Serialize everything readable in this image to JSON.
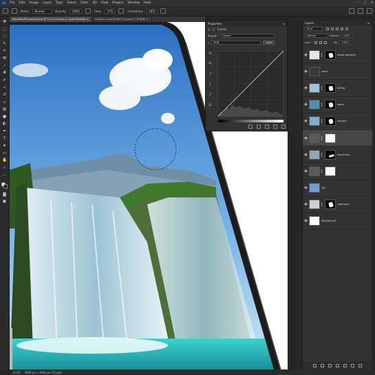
{
  "menubar": {
    "logo": "Ps",
    "items": [
      "File",
      "Edit",
      "Image",
      "Layer",
      "Type",
      "Select",
      "Filter",
      "3D",
      "View",
      "Plugins",
      "Window",
      "Help"
    ],
    "window_controls": [
      "–",
      "□",
      "×"
    ]
  },
  "options": {
    "mode_label": "Mode:",
    "mode_value": "Normal",
    "opacity_label": "Opacity:",
    "opacity_value": "100%",
    "flow_label": "Flow:",
    "flow_value": "37%",
    "smoothing_label": "Smoothing:",
    "smoothing_value": "10%"
  },
  "doctabs": [
    {
      "label": "MadeWithPhotoshop.psd @ 121% (Curves 2, Layer Mask/8) ×",
      "active": true
    },
    {
      "label": "Untitled-1.psd @ 66.7% (Layer 1, RGB/8) ×",
      "active": false
    }
  ],
  "properties": {
    "title": "Properties",
    "subtitle": "Curves",
    "preset_label": "Preset:",
    "preset_value": "Custom",
    "channel_value": "RGB",
    "auto_label": "Auto"
  },
  "layers": {
    "title": "Layers",
    "filter_kind": "Kind",
    "blend_mode": "Normal",
    "opacity_label": "Opacity:",
    "opacity_value": "100%",
    "lock_label": "Lock:",
    "fill_label": "Fill:",
    "fill_value": "100%",
    "items": [
      {
        "name": "inside platform",
        "thumb": "#e6e6e6",
        "mask": "black",
        "selected": false
      },
      {
        "name": "water",
        "thumb": "#3a3a3a",
        "mask": "",
        "selected": false
      },
      {
        "name": "falling",
        "thumb": "#9fc3d8",
        "mask": "black",
        "selected": false
      },
      {
        "name": "water",
        "thumb": "#4f8fb0",
        "mask": "black",
        "selected": false
      },
      {
        "name": "content",
        "thumb": "#7fb0cf",
        "mask": "black",
        "selected": false
      },
      {
        "name": "",
        "thumb": "#5a5a5a",
        "mask": "white",
        "selected": true
      },
      {
        "name": "mountains",
        "thumb": "#8ca7b8",
        "mask": "black",
        "selected": false
      },
      {
        "name": "",
        "thumb": "#5a5a5a",
        "mask": "white",
        "selected": false
      },
      {
        "name": "sky",
        "thumb": "#6aa0d6",
        "mask": "",
        "selected": false
      },
      {
        "name": "cellphone",
        "thumb": "#cfcfcf",
        "mask": "black",
        "selected": false
      },
      {
        "name": "Background",
        "thumb": "#ffffff",
        "mask": "",
        "selected": false
      }
    ]
  },
  "statusbar": {
    "zoom": "121%",
    "doc_info": "3000 px x 3000 px (72 ppi)"
  },
  "colors": {
    "panel_bg": "#323232",
    "sky_top": "#2a6fc2",
    "water": "#2cc1c4",
    "phone_frame": "#1c1c1c"
  }
}
